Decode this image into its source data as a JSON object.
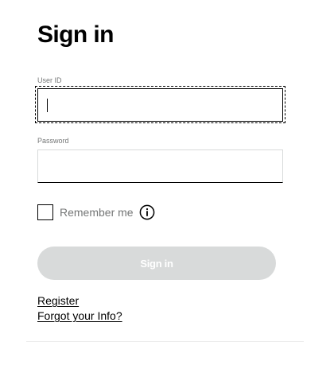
{
  "title": "Sign in",
  "user_id": {
    "label": "User ID",
    "value": "",
    "placeholder": ""
  },
  "password": {
    "label": "Password",
    "value": "",
    "placeholder": ""
  },
  "remember_me": {
    "label": "Remember me",
    "checked": false,
    "info_icon": "info-icon"
  },
  "sign_in_button": {
    "label": "Sign in",
    "enabled": false
  },
  "links": {
    "register": "Register",
    "forgot_info": "Forgot your Info?"
  },
  "colors": {
    "text": "#000000",
    "muted_text": "#747676",
    "disabled_button": "#d8dada",
    "input_border": "#d8dada"
  }
}
